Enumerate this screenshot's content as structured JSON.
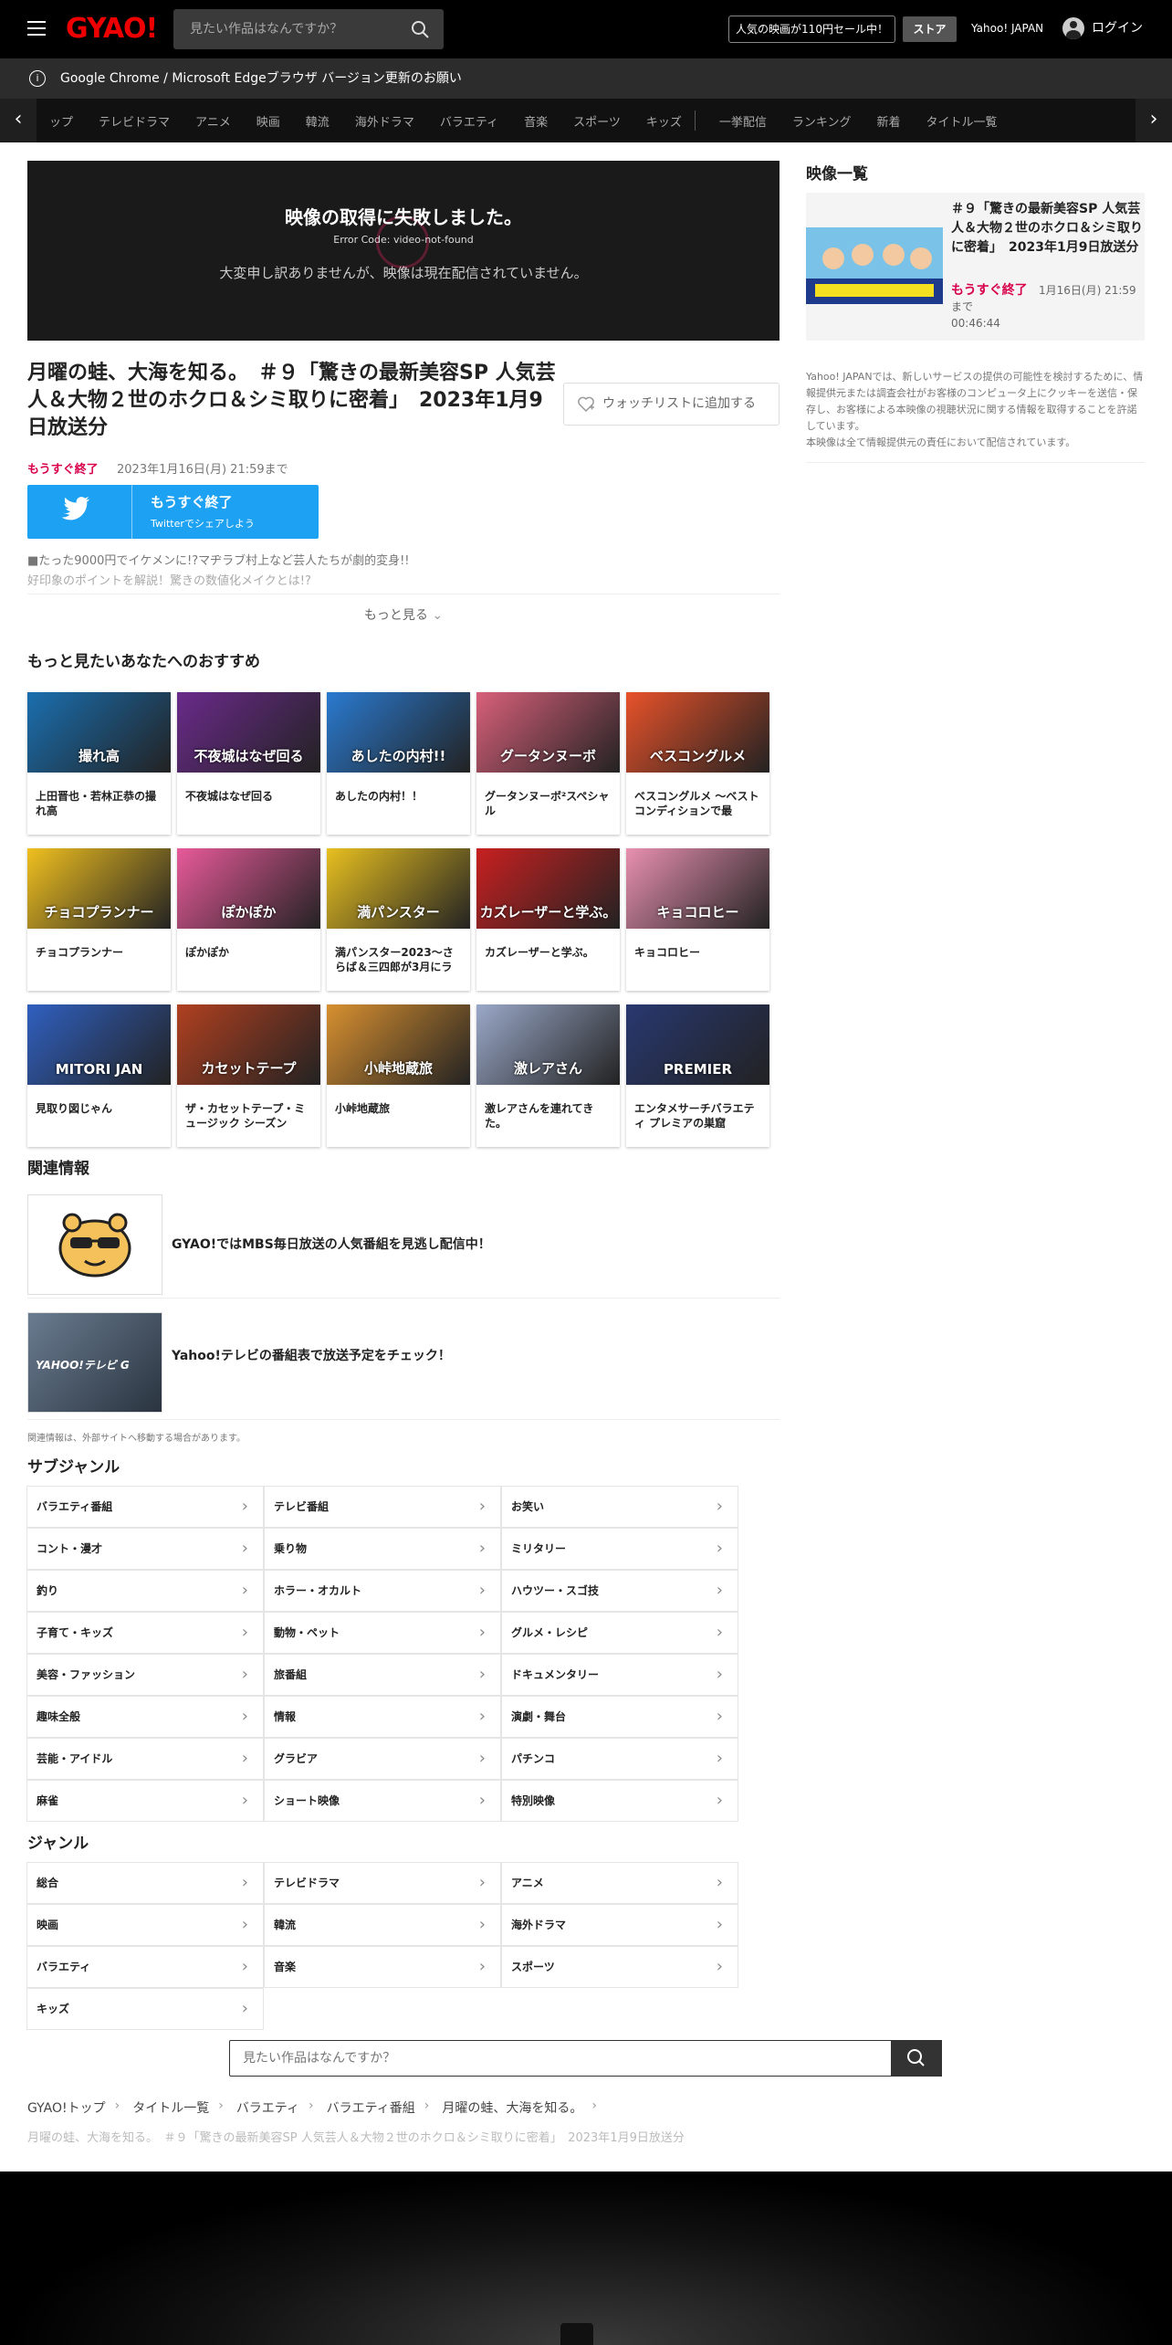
{
  "header": {
    "logo": "GYAO!",
    "search_placeholder": "見たい作品はなんですか？",
    "sale": "人気の映画が110円セール中！",
    "store": "ストア",
    "yahoo": "Yahoo! JAPAN",
    "login": "ログイン"
  },
  "notice": {
    "text": "Google Chrome / Microsoft Edgeブラウザ バージョン更新のお願い"
  },
  "nav": {
    "items": [
      "ップ",
      "テレビドラマ",
      "アニメ",
      "映画",
      "韓流",
      "海外ドラマ",
      "バラエティ",
      "音楽",
      "スポーツ",
      "キッズ",
      "一挙配信",
      "ランキング",
      "新着",
      "タイトル一覧"
    ]
  },
  "player": {
    "error_title": "映像の取得に失敗しました。",
    "error_code": "Error Code: video-not-found",
    "error_msg": "大変申し訳ありませんが、映像は現在配信されていません。"
  },
  "episode": {
    "title": "月曜の蛙、大海を知る。　＃９「驚きの最新美容SP 人気芸人＆大物２世のホクロ＆シミ取りに密着」　2023年1月9日放送分",
    "status": "もうすぐ終了",
    "end_date": "2023年1月16日(月) 21:59まで",
    "watchlist": "ウォッチリストに追加する",
    "share_main": "もうすぐ終了",
    "share_sub": "Twitterでシェアしよう",
    "desc1": "■たった9000円でイケメンに!?マヂラブ村上など芸人たちが劇的変身!!",
    "desc2": "好印象のポイントを解説！驚きの数値化メイクとは!?",
    "more": "もっと見る"
  },
  "recommend": {
    "heading": "もっと見たいあなたへのおすすめ",
    "items": [
      {
        "label": "上田晋也・若林正恭の撮れ高",
        "thumb": "撮れ高",
        "color": "#1a6fb0"
      },
      {
        "label": "不夜城はなぜ回る",
        "thumb": "不夜城はなぜ回る",
        "color": "#6a2a8a"
      },
      {
        "label": "あしたの内村！！",
        "thumb": "あしたの内村!!",
        "color": "#2a7ad0"
      },
      {
        "label": "グータンヌーボ²スペシャル",
        "thumb": "グータンヌーボ",
        "color": "#d8607a"
      },
      {
        "label": "ベスコングルメ 〜ベストコンディションで最",
        "thumb": "ベスコングルメ",
        "color": "#e8522a"
      },
      {
        "label": "チョコプランナー",
        "thumb": "チョコプランナー",
        "color": "#f0c020"
      },
      {
        "label": "ぽかぽか",
        "thumb": "ぽかぽか",
        "color": "#e85a9a"
      },
      {
        "label": "満パンスター2023〜さらば＆三四郎が3月にラ",
        "thumb": "満パンスター",
        "color": "#e8c020"
      },
      {
        "label": "カズレーザーと学ぶ。",
        "thumb": "カズレーザーと学ぶ。",
        "color": "#c82020"
      },
      {
        "label": "キョコロヒー",
        "thumb": "キョコロヒー",
        "color": "#e890b0"
      },
      {
        "label": "見取り図じゃん",
        "thumb": "MITORI JAN",
        "color": "#3060c0"
      },
      {
        "label": "ザ・カセットテープ・ミュージック シーズン",
        "thumb": "カセットテープ",
        "color": "#b04020"
      },
      {
        "label": "小峠地蔵旅",
        "thumb": "小峠地蔵旅",
        "color": "#d89030"
      },
      {
        "label": "激レアさんを連れてきた。",
        "thumb": "激レアさん",
        "color": "#9aa8c8"
      },
      {
        "label": "エンタメサーチバラエティ プレミアの巣窟",
        "thumb": "PREMIER",
        "color": "#283870"
      }
    ]
  },
  "related": {
    "heading": "関連情報",
    "items": [
      {
        "text": "GYAO!ではMBS毎日放送の人気番組を見逃し配信中！"
      },
      {
        "text": "Yahoo!テレビの番組表で放送予定をチェック！"
      }
    ],
    "note": "関連情報は、外部サイトへ移動する場合があります。"
  },
  "subgenre": {
    "heading": "サブジャンル",
    "items": [
      "バラエティ番組",
      "テレビ番組",
      "お笑い",
      "コント・漫才",
      "乗り物",
      "ミリタリー",
      "釣り",
      "ホラー・オカルト",
      "ハウツー・スゴ技",
      "子育て・キッズ",
      "動物・ペット",
      "グルメ・レシピ",
      "美容・ファッション",
      "旅番組",
      "ドキュメンタリー",
      "趣味全般",
      "情報",
      "演劇・舞台",
      "芸能・アイドル",
      "グラビア",
      "パチンコ",
      "麻雀",
      "ショート映像",
      "特別映像"
    ]
  },
  "genre": {
    "heading": "ジャンル",
    "items": [
      "総合",
      "テレビドラマ",
      "アニメ",
      "映画",
      "韓流",
      "海外ドラマ",
      "バラエティ",
      "音楽",
      "スポーツ",
      "キッズ"
    ]
  },
  "bottom_search": {
    "placeholder": "見たい作品はなんですか？"
  },
  "breadcrumb": {
    "items": [
      "GYAO!トップ",
      "タイトル一覧",
      "バラエティ",
      "バラエティ番組",
      "月曜の蛙、大海を知る。"
    ],
    "current": "月曜の蛙、大海を知る。　＃９「驚きの最新美容SP 人気芸人＆大物２世のホクロ＆シミ取りに密着」　2023年1月9日放送分"
  },
  "sidebar": {
    "heading": "映像一覧",
    "item": {
      "title": "＃９「驚きの最新美容SP 人気芸人＆大物２世のホクロ＆シミ取りに密着」　2023年1月9日放送分",
      "status": "もうすぐ終了",
      "date": "1月16日(月) 21:59",
      "suffix": "まで",
      "duration": "00:46:44"
    },
    "note1": "Yahoo! JAPANでは、新しいサービスの提供の可能性を検討するために、情報提供元または調査会社がお客様のコンピュータ上にクッキーを送信・保存し、お客様による本映像の視聴状況に関する情報を取得することを許諾しています。",
    "note2": "本映像は全て情報提供元の責任において配信されています。"
  }
}
